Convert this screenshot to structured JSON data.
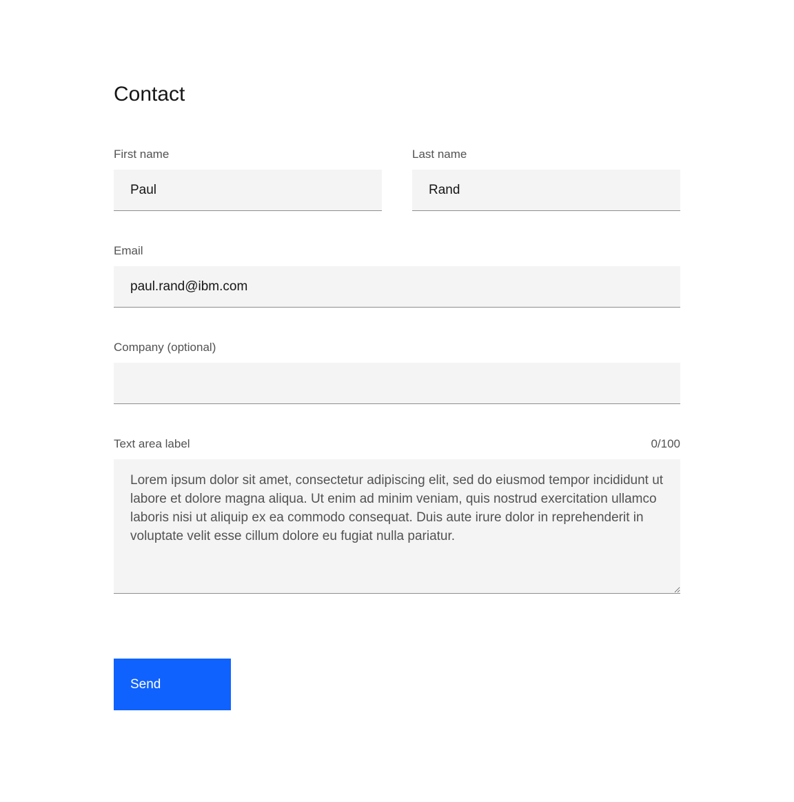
{
  "form": {
    "title": "Contact",
    "first_name": {
      "label": "First name",
      "value": "Paul"
    },
    "last_name": {
      "label": "Last name",
      "value": "Rand"
    },
    "email": {
      "label": "Email",
      "value": "paul.rand@ibm.com"
    },
    "company": {
      "label": "Company (optional)",
      "value": ""
    },
    "message": {
      "label": "Text area label",
      "counter": "0/100",
      "value": "Lorem ipsum dolor sit amet, consectetur adipiscing elit, sed do eiusmod tempor incididunt ut labore et dolore magna aliqua. Ut enim ad minim veniam, quis nostrud exercitation ullamco laboris nisi ut aliquip ex ea commodo consequat. Duis aute irure dolor in reprehenderit in voluptate velit esse cillum dolore eu fugiat nulla pariatur."
    },
    "submit_label": "Send"
  },
  "colors": {
    "primary": "#0f62fe",
    "field_bg": "#f4f4f4",
    "text": "#161616",
    "label": "#525252"
  }
}
